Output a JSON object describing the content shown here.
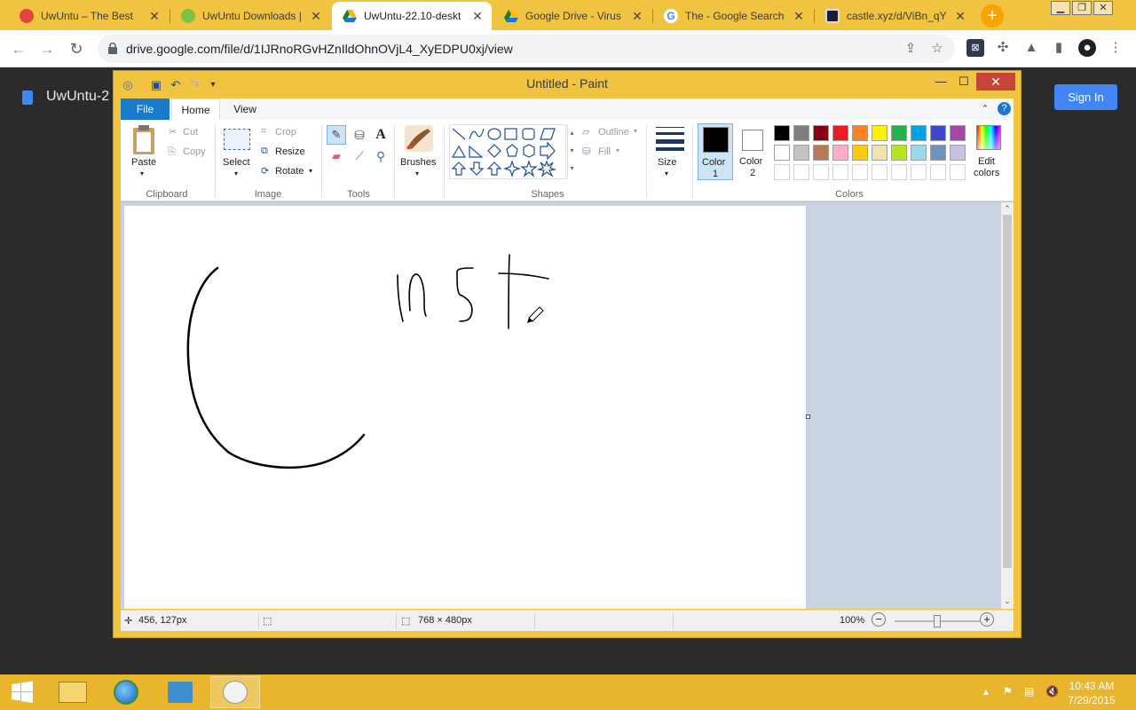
{
  "browser": {
    "tabs": [
      {
        "title": "UwUntu – The Best",
        "favicon_color": "#e2453c",
        "active": false
      },
      {
        "title": "UwUntu Downloads |",
        "favicon_color": "#7dc242",
        "active": false
      },
      {
        "title": "UwUntu-22.10-deskt",
        "favicon_color": "#1a73e8",
        "active": true
      },
      {
        "title": "Google Drive - Virus",
        "favicon_color": "#1a73e8",
        "active": false
      },
      {
        "title": "The - Google Search",
        "favicon_color": "#4285f4",
        "active": false
      },
      {
        "title": "castle.xyz/d/ViBn_qY",
        "favicon_color": "#1b1b3a",
        "active": false
      }
    ],
    "new_tab_label": "+",
    "url": "drive.google.com/file/d/1IJRnoRGvHZnIldOhnOVjL4_XyEDPU0xj/view",
    "back_icon": "←",
    "forward_icon": "→",
    "reload_icon": "↻"
  },
  "drive": {
    "file_title": "UwUntu-2",
    "sign_in_label": "Sign In"
  },
  "paint": {
    "window_title": "Untitled - Paint",
    "ribbon_tabs": {
      "file": "File",
      "home": "Home",
      "view": "View"
    },
    "clipboard": {
      "paste": "Paste",
      "cut": "Cut",
      "copy": "Copy",
      "group": "Clipboard"
    },
    "image": {
      "select": "Select",
      "crop": "Crop",
      "resize": "Resize",
      "rotate": "Rotate",
      "group": "Image"
    },
    "tools": {
      "group": "Tools"
    },
    "brushes": {
      "label": "Brushes"
    },
    "shapes": {
      "outline": "Outline",
      "fill": "Fill",
      "group": "Shapes"
    },
    "size": {
      "label": "Size"
    },
    "color1": {
      "label_line1": "Color",
      "label_line2": "1",
      "value": "#000000"
    },
    "color2": {
      "label_line1": "Color",
      "label_line2": "2",
      "value": "#ffffff"
    },
    "colors": {
      "group": "Colors",
      "edit_line1": "Edit",
      "edit_line2": "colors",
      "row1": [
        "#000000",
        "#7f7f7f",
        "#880015",
        "#ed1c24",
        "#ff7f27",
        "#fff200",
        "#22b14c",
        "#00a2e8",
        "#3f48cc",
        "#a349a4"
      ],
      "row2": [
        "#ffffff",
        "#c3c3c3",
        "#b97a57",
        "#ffaec9",
        "#ffc90e",
        "#efe4b0",
        "#b5e61d",
        "#99d9ea",
        "#7092be",
        "#c8bfe7"
      ]
    },
    "status": {
      "cursor_pos": "456, 127px",
      "canvas_size": "768 × 480px",
      "zoom": "100%",
      "zoom_level": 0.5
    }
  },
  "taskbar": {
    "time": "10:43 AM",
    "date": "7/29/2015"
  }
}
